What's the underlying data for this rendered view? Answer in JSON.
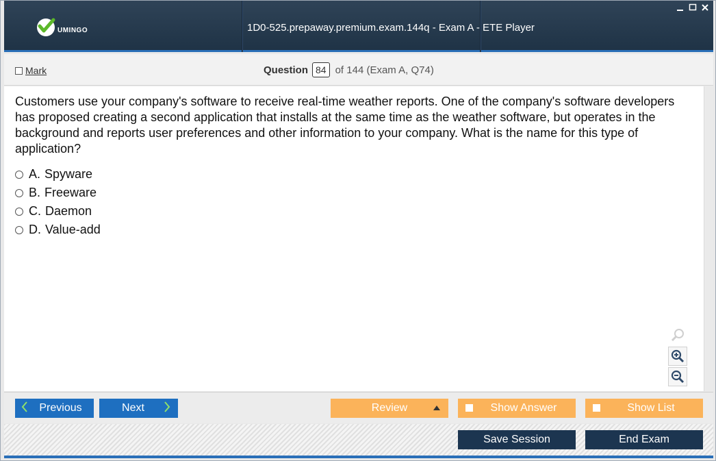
{
  "titlebar": {
    "brand": "UMINGO",
    "title": "1D0-525.prepaway.premium.exam.144q - Exam A - ETE Player",
    "window_controls": [
      "minimize-icon",
      "maximize-icon",
      "close-icon"
    ],
    "accent": "#2a6fb8"
  },
  "question_bar": {
    "mark_label": "Mark",
    "question_label": "Question",
    "question_number": "84",
    "of_text": "of 144 (Exam A, Q74)"
  },
  "question": {
    "text": "Customers use your company's software to receive real-time weather reports. One of the company's software developers has proposed creating a second application that installs at the same time as the weather software, but operates in the background and reports user preferences and other information to your company. What is the name for this type of application?",
    "options": [
      {
        "letter": "A.",
        "text": "Spyware"
      },
      {
        "letter": "B.",
        "text": "Freeware"
      },
      {
        "letter": "C.",
        "text": "Daemon"
      },
      {
        "letter": "D.",
        "text": "Value-add"
      }
    ]
  },
  "zoom_tools": [
    "magnifier-icon",
    "zoom-in-icon",
    "zoom-out-icon"
  ],
  "navigation": {
    "previous_label": "Previous",
    "next_label": "Next",
    "review_label": "Review",
    "show_answer_label": "Show Answer",
    "show_list_label": "Show List",
    "nav_color": "#1e6fc0",
    "option_color": "#fbb35a"
  },
  "session": {
    "save_label": "Save Session",
    "end_label": "End Exam",
    "color": "#1c3550"
  }
}
